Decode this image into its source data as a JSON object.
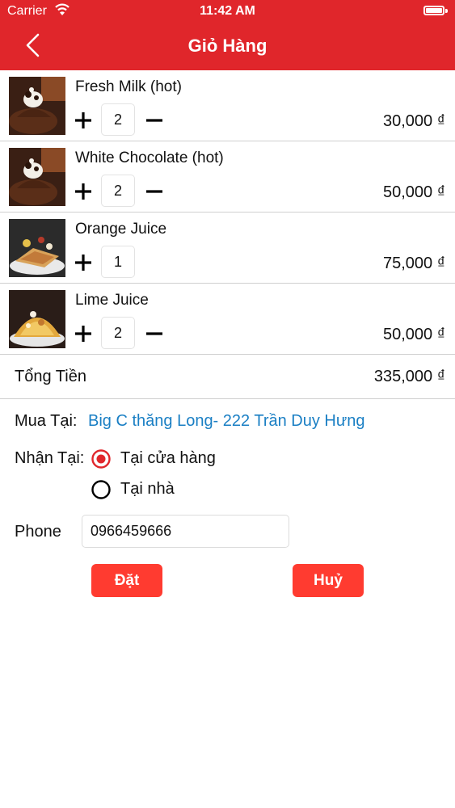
{
  "status_bar": {
    "carrier": "Carrier",
    "time": "11:42 AM"
  },
  "header": {
    "title": "Giỏ Hàng",
    "back_icon": "chevron-left-icon",
    "color": "#e0262b"
  },
  "cart": {
    "items": [
      {
        "name": "Fresh Milk (hot)",
        "qty": "2",
        "price": "30,000 ₫"
      },
      {
        "name": "White Chocolate (hot)",
        "qty": "2",
        "price": "50,000 ₫"
      },
      {
        "name": "Orange Juice",
        "qty": "1",
        "price": "75,000 ₫"
      },
      {
        "name": "Lime Juice",
        "qty": "2",
        "price": "50,000 ₫"
      }
    ],
    "total_label": "Tổng Tiền",
    "total_value": "335,000 ₫"
  },
  "order": {
    "buy_at_label": "Mua Tại:",
    "store": "Big C thăng Long- 222 Trần Duy Hưng",
    "receive_label": "Nhận Tại:",
    "receive_options": [
      {
        "label": "Tại cửa hàng",
        "selected": true
      },
      {
        "label": "Tại nhà",
        "selected": false
      }
    ],
    "phone_label": "Phone",
    "phone_value": "0966459666",
    "submit_label": "Đặt",
    "cancel_label": "Huỷ"
  },
  "colors": {
    "accent": "#e0262b",
    "button": "#ff3b30",
    "link": "#1a7fc4"
  }
}
